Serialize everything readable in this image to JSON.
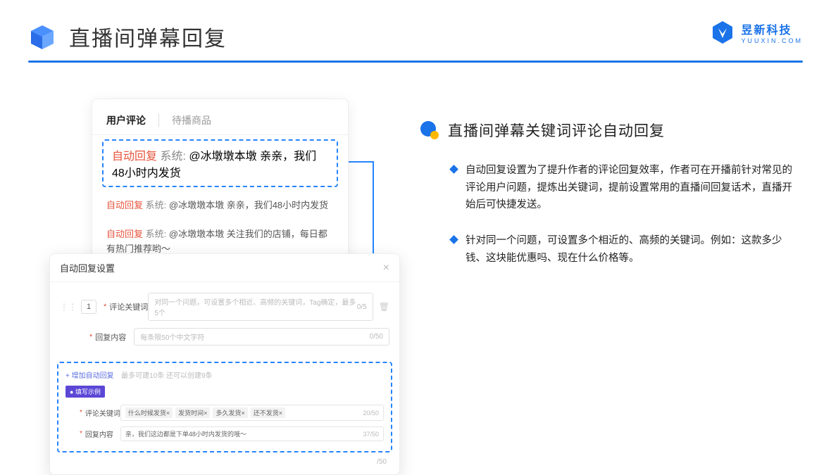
{
  "header": {
    "title": "直播间弹幕回复",
    "brand_cn": "昱新科技",
    "brand_en": "YUUXIN.COM"
  },
  "comments": {
    "tab_active": "用户评论",
    "tab_other": "待播商品",
    "items": [
      {
        "auto": "自动回复",
        "sys": "系统:",
        "text": "@冰墩墩本墩 亲亲，我们48小时内发货"
      },
      {
        "auto": "自动回复",
        "sys": "系统:",
        "text": "@冰墩墩本墩 亲亲，我们48小时内发货"
      },
      {
        "auto": "自动回复",
        "sys": "系统:",
        "text": "@冰墩墩本墩 关注我们的店铺，每日都有热门推荐哟～"
      }
    ]
  },
  "settings": {
    "title": "自动回复设置",
    "num": "1",
    "kw_label": "评论关键词",
    "kw_placeholder": "对同一个问题，可设置多个相近、高频的关键词，Tag确定，最多5个",
    "kw_count": "0/5",
    "reply_label": "回复内容",
    "reply_placeholder": "每条限50个中文字符",
    "reply_count": "0/50",
    "add_link": "+ 增加自动回复",
    "add_hint": "最多可建10条 还可以创建9条",
    "badge": "● 填写示例",
    "ex_kw_label": "评论关键词",
    "ex_tags": [
      "什么时候发货×",
      "发货时间×",
      "多久发货×",
      "还不发货×"
    ],
    "ex_kw_count": "20/50",
    "ex_reply_label": "回复内容",
    "ex_reply_text": "亲，我们这边都是下单48小时内发货的哦～",
    "ex_reply_count": "37/50",
    "outer_count": "/50"
  },
  "right": {
    "title": "直播间弹幕关键词评论自动回复",
    "bullets": [
      "自动回复设置为了提升作者的评论回复效率，作者可在开播前针对常见的评论用户问题，提炼出关键词，提前设置常用的直播间回复话术，直播开始后可快捷发送。",
      "针对同一个问题，可设置多个相近的、高频的关键词。例如：这款多少钱、这块能优惠吗、现在什么价格等。"
    ]
  }
}
